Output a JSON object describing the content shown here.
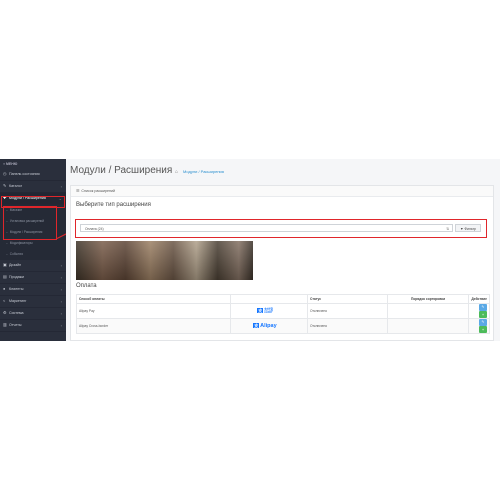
{
  "sidebar": {
    "menu_label": "МЕНЮ",
    "items": [
      {
        "icon": "dashboard-icon",
        "glyph": "◷",
        "label": "Панель состояния",
        "chevron": ""
      },
      {
        "icon": "tag-icon",
        "glyph": "✎",
        "label": "Каталог",
        "chevron": "›"
      },
      {
        "icon": "puzzle-icon",
        "glyph": "✚",
        "label": "Модули / Расширения",
        "chevron": "⌄"
      }
    ],
    "subitems": [
      {
        "label": "Магазин"
      },
      {
        "label": "Установка расширений"
      },
      {
        "label": "Модули / Расширения"
      },
      {
        "label": "Модификаторы"
      },
      {
        "label": "События"
      }
    ],
    "items_after": [
      {
        "icon": "desktop-icon",
        "glyph": "▣",
        "label": "Дизайн",
        "chevron": "›"
      },
      {
        "icon": "cart-icon",
        "glyph": "▤",
        "label": "Продажи",
        "chevron": "›"
      },
      {
        "icon": "user-icon",
        "glyph": "●",
        "label": "Клиенты",
        "chevron": "›"
      },
      {
        "icon": "share-icon",
        "glyph": "<",
        "label": "Маркетинг",
        "chevron": "›"
      },
      {
        "icon": "gear-icon",
        "glyph": "⚙",
        "label": "Система",
        "chevron": "›"
      },
      {
        "icon": "chart-icon",
        "glyph": "▥",
        "label": "Отчеты",
        "chevron": "›"
      }
    ]
  },
  "header": {
    "title": "Модули / Расширения",
    "home_icon": "⌂",
    "breadcrumb": "Модули / Расширения"
  },
  "panel": {
    "heading_icon": "☰",
    "heading": "Список расширений",
    "choose_type": "Выберите тип расширения",
    "select_value": "Оплата (24)",
    "select_caret": "⇅",
    "filter_label": "▼ Фильтр",
    "section_title": "Оплата"
  },
  "table": {
    "headers": [
      "Способ оплаты",
      "",
      "Статус",
      "Порядок сортировки",
      "Действие"
    ],
    "rows": [
      {
        "name": "Alipay Pay",
        "logo_top": "支付宝",
        "logo_bottom": "ALIPAY",
        "status": "Отключено",
        "order": ""
      },
      {
        "name": "Alipay Cross-border",
        "logo_top": "支",
        "logo_bottom": "Alipay",
        "status": "Отключено",
        "order": ""
      }
    ],
    "edit_glyph": "✎",
    "add_glyph": "+"
  },
  "colors": {
    "highlight": "#e0262b",
    "sidebar_bg": "#2a2f3c",
    "link": "#2a8fcf",
    "alipay": "#1677ff",
    "add_btn": "#4cbb5a",
    "edit_btn": "#5aa9e6"
  }
}
